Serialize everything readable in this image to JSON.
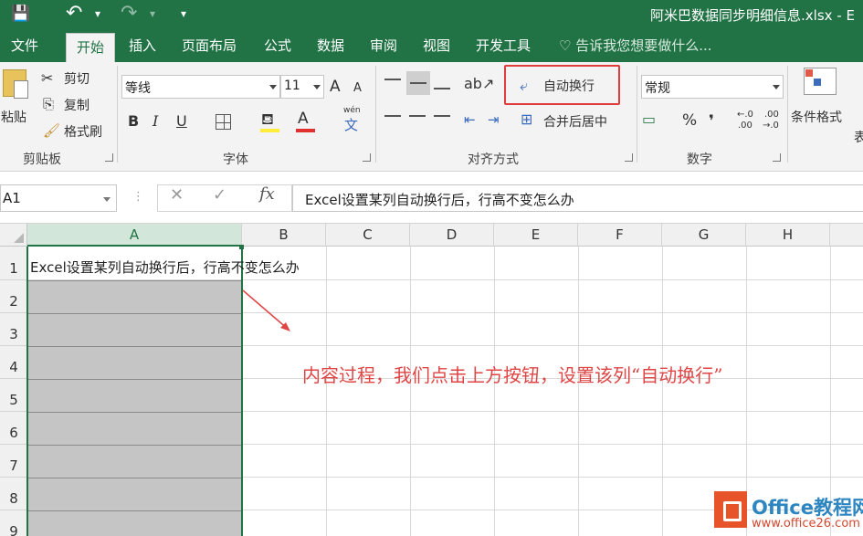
{
  "titlebar": {
    "window_title": "阿米巴数据同步明细信息.xlsx - E",
    "save_icon": "💾",
    "undo_icon": "↶",
    "redo_icon": "↷",
    "customize_icon": "▾"
  },
  "tabs": [
    {
      "label": "文件"
    },
    {
      "label": "开始"
    },
    {
      "label": "插入"
    },
    {
      "label": "页面布局"
    },
    {
      "label": "公式"
    },
    {
      "label": "数据"
    },
    {
      "label": "审阅"
    },
    {
      "label": "视图"
    },
    {
      "label": "开发工具"
    }
  ],
  "tell_me": "告诉我您想要做什么...",
  "ribbon": {
    "clipboard": {
      "paste": "粘贴",
      "cut": "剪切",
      "copy": "复制",
      "format_painter": "格式刷",
      "group_label": "剪贴板"
    },
    "font": {
      "font_name": "等线",
      "font_size": "11",
      "bold": "B",
      "italic": "I",
      "underline": "U",
      "grow": "A",
      "shrink": "A",
      "font_color": "A",
      "phonetic_top": "wén",
      "phonetic_char": "文",
      "group_label": "字体",
      "highlight_color": "#ffeb3b",
      "text_color": "#e03030"
    },
    "alignment": {
      "wrap_text": "自动换行",
      "merge_center": "合并后居中",
      "group_label": "对齐方式"
    },
    "number": {
      "format": "常规",
      "percent": "%",
      "comma": "❜",
      "inc_decimal_top": "←.0",
      "inc_decimal_bottom": ".00",
      "dec_decimal_top": ".00",
      "dec_decimal_bottom": "→.0",
      "group_label": "数字"
    },
    "styles": {
      "conditional_format": "条件格式",
      "table_partial": "表"
    }
  },
  "formula_bar": {
    "name_box": "A1",
    "cancel": "✕",
    "confirm": "✓",
    "fx": "fx",
    "content": "Excel设置某列自动换行后，行高不变怎么办"
  },
  "grid": {
    "columns": [
      "A",
      "B",
      "C",
      "D",
      "E",
      "F",
      "G",
      "H"
    ],
    "rows": [
      "1",
      "2",
      "3",
      "4",
      "5",
      "6",
      "7",
      "8",
      "9"
    ],
    "cell_a1": "Excel设置某列自动换行后，行高不变怎么办"
  },
  "annotation": "内容过程，我们点击上方按钮，设置该列“自动换行”",
  "watermark": {
    "name": "Office教程网",
    "url": "www.office26.com"
  },
  "colors": {
    "excel_green": "#217346",
    "annotation_red": "#e04545",
    "selection_gray": "#c5c5c5"
  }
}
